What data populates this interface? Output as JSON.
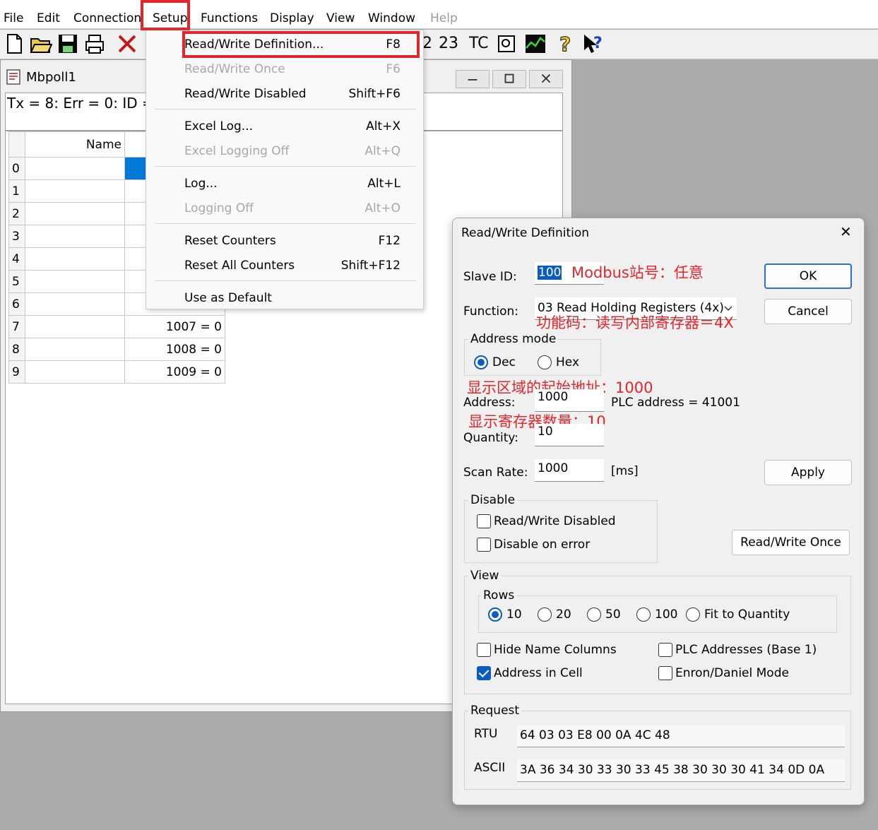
{
  "menubar": {
    "items": [
      {
        "label": "File"
      },
      {
        "label": "Edit"
      },
      {
        "label": "Connection"
      },
      {
        "label": "Setup"
      },
      {
        "label": "Functions"
      },
      {
        "label": "Display"
      },
      {
        "label": "View"
      },
      {
        "label": "Window"
      },
      {
        "label": "Help"
      }
    ]
  },
  "toolbar": {
    "text_buttons": [
      "2",
      "23",
      "TC"
    ],
    "icons": [
      "new-file-icon",
      "open-folder-icon",
      "save-icon",
      "print-icon",
      "delete-icon",
      "copy-icon",
      "chart-icon",
      "help-icon",
      "context-help-icon"
    ]
  },
  "child_window": {
    "title": "Mbpoll1",
    "status": "Tx = 8: Err = 0: ID =",
    "grid": {
      "header_name": "Name",
      "row_numbers": [
        "0",
        "1",
        "2",
        "3",
        "4",
        "5",
        "6",
        "7",
        "8",
        "9"
      ],
      "visible_values": [
        {
          "row": "7",
          "value": "1007 = 0"
        },
        {
          "row": "8",
          "value": "1008 = 0"
        },
        {
          "row": "9",
          "value": "1009 = 0"
        }
      ]
    }
  },
  "setup_menu": {
    "items": [
      {
        "label": "Read/Write Definition...",
        "shortcut": "F8",
        "enabled": true
      },
      {
        "label": "Read/Write Once",
        "shortcut": "F6",
        "enabled": false
      },
      {
        "label": "Read/Write Disabled",
        "shortcut": "Shift+F6",
        "enabled": true
      },
      {
        "label": "Excel Log...",
        "shortcut": "Alt+X",
        "enabled": true
      },
      {
        "label": "Excel Logging Off",
        "shortcut": "Alt+Q",
        "enabled": false
      },
      {
        "label": "Log...",
        "shortcut": "Alt+L",
        "enabled": true
      },
      {
        "label": "Logging Off",
        "shortcut": "Alt+O",
        "enabled": false
      },
      {
        "label": "Reset Counters",
        "shortcut": "F12",
        "enabled": true
      },
      {
        "label": "Reset All Counters",
        "shortcut": "Shift+F12",
        "enabled": true
      },
      {
        "label": "Use as Default",
        "shortcut": "",
        "enabled": true
      }
    ]
  },
  "dialog": {
    "title": "Read/Write Definition",
    "close_glyph": "✕",
    "slave_id_label": "Slave ID:",
    "slave_id_value": "100",
    "function_label": "Function:",
    "function_value": "03 Read Holding Registers (4x)",
    "address_mode_label": "Address mode",
    "dec_label": "Dec",
    "hex_label": "Hex",
    "address_label": "Address:",
    "address_value": "1000",
    "plc_address_text": "PLC address = 41001",
    "quantity_label": "Quantity:",
    "quantity_value": "10",
    "scan_rate_label": "Scan Rate:",
    "scan_rate_value": "1000",
    "scan_rate_unit": "[ms]",
    "ok_label": "OK",
    "cancel_label": "Cancel",
    "apply_label": "Apply",
    "disable_group": "Disable",
    "rw_disabled_label": "Read/Write Disabled",
    "disable_on_error_label": "Disable on error",
    "rw_once_label": "Read/Write Once",
    "view_group": "View",
    "rows_group": "Rows",
    "rows_options": [
      "10",
      "20",
      "50",
      "100",
      "Fit to Quantity"
    ],
    "hide_name_label": "Hide Name Columns",
    "plc_base1_label": "PLC Addresses (Base 1)",
    "address_in_cell_label": "Address in Cell",
    "enron_label": "Enron/Daniel Mode",
    "request_group": "Request",
    "rtu_label": "RTU",
    "rtu_value": "64 03 03 E8 00 0A 4C 48",
    "ascii_label": "ASCII",
    "ascii_value": "3A 36 34 30 33 30 33 45 38 30 30 30 41 34 0D 0A"
  },
  "annotations": {
    "slave_id": "Modbus站号：任意",
    "function": "功能码：读写内部寄存器＝4X",
    "address": "显示区域的起始地址：1000",
    "quantity": "显示寄存器数量：10"
  },
  "colors": {
    "highlight_red": "#e5252c",
    "accent_blue": "#0a5cc2"
  }
}
